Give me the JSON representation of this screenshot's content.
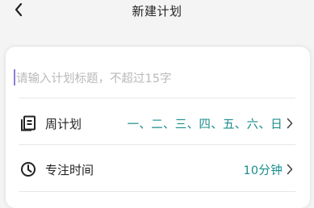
{
  "header": {
    "title": "新建计划",
    "back_icon": "chevron-left-icon"
  },
  "form": {
    "title_placeholder": "请输入计划标题，不超过15字",
    "rows": [
      {
        "icon": "weekly-plan-icon",
        "label": "周计划",
        "value": "一、二、三、四、五、六、日"
      },
      {
        "icon": "clock-icon",
        "label": "专注时间",
        "value": "10分钟"
      }
    ]
  },
  "colors": {
    "accent": "#1a8c8c",
    "caret": "#8a7fd6",
    "placeholder": "#b9b9b9",
    "background": "#f4f4f4",
    "card": "#ffffff"
  }
}
